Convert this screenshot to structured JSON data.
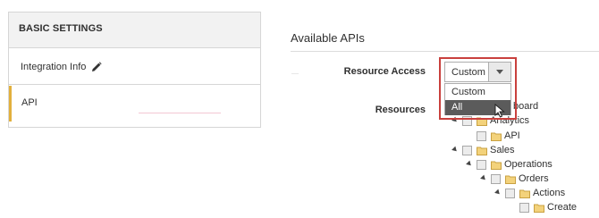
{
  "settings": {
    "header": "BASIC SETTINGS",
    "items": [
      {
        "label": "Integration Info",
        "icon": "pencil-icon"
      },
      {
        "label": "API",
        "active": true
      }
    ],
    "active_color": "#e2b03c"
  },
  "main": {
    "title": "Available APIs",
    "resource_access": {
      "label": "Resource Access",
      "selected": "Custom",
      "options": [
        "Custom",
        "All"
      ],
      "highlighted_option": "All",
      "highlight_color": "#c9403d"
    },
    "resources": {
      "label": "Resources",
      "tree": [
        {
          "label": "Dashboard",
          "visible_text": "board",
          "level": 0
        },
        {
          "label": "Analytics",
          "level": 1
        },
        {
          "label": "API",
          "level": 2
        },
        {
          "label": "Sales",
          "level": 1
        },
        {
          "label": "Operations",
          "level": 2
        },
        {
          "label": "Orders",
          "level": 3
        },
        {
          "label": "Actions",
          "level": 4
        },
        {
          "label": "Create",
          "level": 5
        }
      ]
    }
  }
}
